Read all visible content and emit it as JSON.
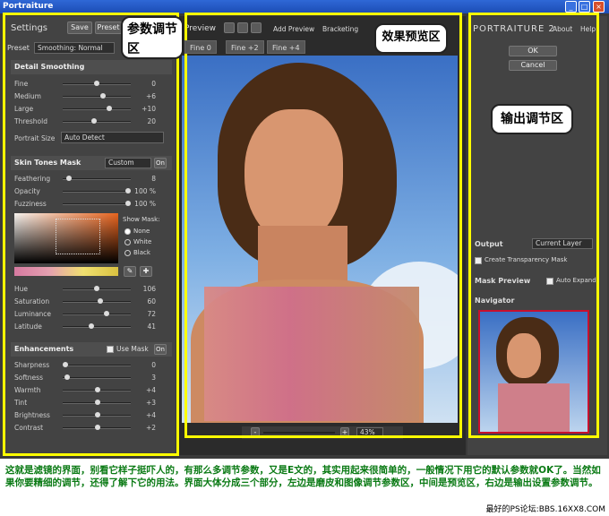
{
  "window": {
    "title": "Portraiture",
    "min": "_",
    "max": "□",
    "close": "×"
  },
  "settings": {
    "title": "Settings",
    "save": "Save",
    "preset_btn": "Preset",
    "preset_label": "Preset",
    "preset_value": "Smoothing: Normal",
    "detail_title": "Detail Smoothing",
    "detail": [
      {
        "label": "Fine",
        "value": "0",
        "level": 0.5
      },
      {
        "label": "Medium",
        "value": "+6",
        "level": 0.6
      },
      {
        "label": "Large",
        "value": "+10",
        "level": 0.7
      },
      {
        "label": "Threshold",
        "value": "20",
        "level": 0.45
      }
    ],
    "portrait_size_label": "Portrait Size",
    "portrait_size_value": "Auto Detect",
    "skin_title": "Skin Tones Mask",
    "skin_mode": "Custom",
    "skin_on": "On",
    "skin": [
      {
        "label": "Feathering",
        "value": "8",
        "level": 0.05
      },
      {
        "label": "Opacity",
        "value": "100 %",
        "level": 1
      },
      {
        "label": "Fuzziness",
        "value": "100 %",
        "level": 1
      }
    ],
    "show_mask_label": "Show Mask:",
    "show_mask_options": [
      "None",
      "White",
      "Black"
    ],
    "hsl": [
      {
        "label": "Hue",
        "value": "106",
        "level": 0.5
      },
      {
        "label": "Saturation",
        "value": "60",
        "level": 0.55
      },
      {
        "label": "Luminance",
        "value": "72",
        "level": 0.65
      },
      {
        "label": "Latitude",
        "value": "41",
        "level": 0.42
      }
    ],
    "enh_title": "Enhancements",
    "use_mask": "Use Mask",
    "enh_on": "On",
    "enh": [
      {
        "label": "Sharpness",
        "value": "0",
        "level": 0.0
      },
      {
        "label": "Softness",
        "value": "3",
        "level": 0.03
      },
      {
        "label": "Warmth",
        "value": "+4",
        "level": 0.52
      },
      {
        "label": "Tint",
        "value": "+3",
        "level": 0.51
      },
      {
        "label": "Brightness",
        "value": "+4",
        "level": 0.52
      },
      {
        "label": "Contrast",
        "value": "+2",
        "level": 0.51
      }
    ]
  },
  "preview": {
    "label": "Preview",
    "add_preview": "Add Preview",
    "bracketing": "Bracketing",
    "tabs": [
      "Fine 0",
      "Fine +2",
      "Fine +4"
    ],
    "zoom": "43%",
    "minus": "-",
    "plus": "+"
  },
  "output": {
    "brand": "PORTRAITURE 2",
    "about": "About",
    "help": "Help",
    "ok": "OK",
    "cancel": "Cancel",
    "output_label": "Output",
    "layer": "Current Layer",
    "transparency": "Create Transparency Mask",
    "mask_preview": "Mask Preview",
    "auto_expand": "Auto Expand",
    "navigator": "Navigator"
  },
  "annotations": {
    "params": "参数调节区",
    "preview": "效果预览区",
    "output": "输出调节区"
  },
  "caption": "这就是滤镜的界面，别看它样子挺吓人的，有那么多调节参数，又是E文的，其实用起来很简单的，一般情况下用它的默认参数就OK了。当然如果你要精细的调节，还得了解下它的用法。界面大体分成三个部分，左边是磨皮和图像调节参数区，中间是预览区，右边是输出设置参数调节。",
  "footer": "最好的PS论坛:BBS.16XX8.COM"
}
